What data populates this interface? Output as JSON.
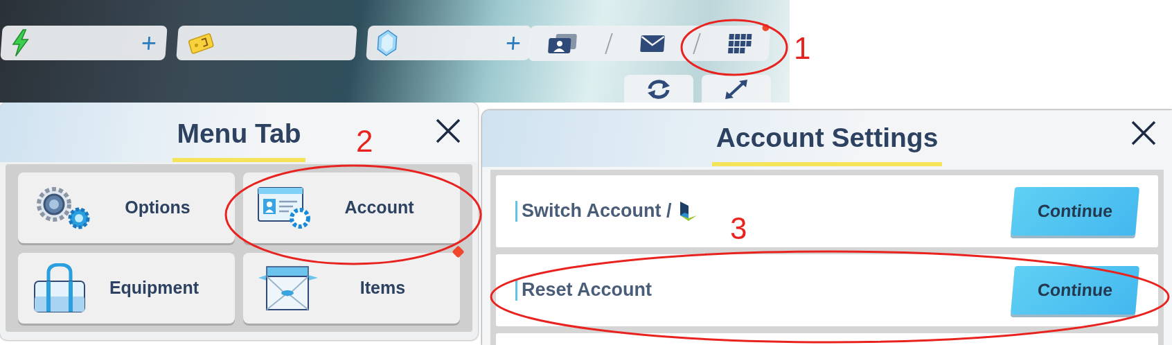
{
  "resource_bar": [
    {
      "kind": "energy",
      "plus": "+"
    },
    {
      "kind": "ticket"
    },
    {
      "kind": "gem",
      "plus": "+"
    }
  ],
  "toolbar": [
    {
      "kind": "profile",
      "notification": false
    },
    {
      "kind": "mail",
      "notification": false
    },
    {
      "kind": "menu",
      "notification": true
    }
  ],
  "secondary_toolbar": [
    {
      "kind": "refresh"
    },
    {
      "kind": "expand"
    }
  ],
  "menu_panel": {
    "title": "Menu Tab",
    "items": [
      {
        "kind": "options",
        "label": "Options",
        "notification": false
      },
      {
        "kind": "account",
        "label": "Account",
        "notification": false
      },
      {
        "kind": "equipment",
        "label": "Equipment",
        "notification": false
      },
      {
        "kind": "items",
        "label": "Items",
        "notification": true
      }
    ]
  },
  "account_panel": {
    "title": "Account Settings",
    "rows": [
      {
        "label": "Switch Account /",
        "logo": true,
        "button": "Continue"
      },
      {
        "label": "Reset Account",
        "logo": false,
        "button": "Continue"
      }
    ]
  },
  "annotations": [
    {
      "label": "1"
    },
    {
      "label": "2"
    },
    {
      "label": "3"
    }
  ]
}
